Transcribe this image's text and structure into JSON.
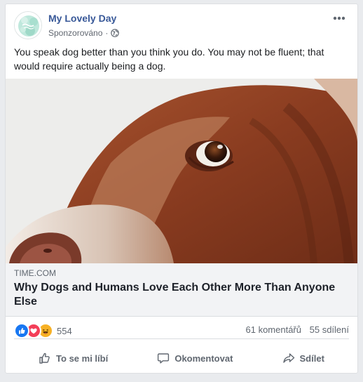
{
  "post": {
    "page_name": "My Lovely Day",
    "sponsored_label": "Sponzorováno",
    "sponsored_separator": "·",
    "text": "You speak dog better than you think you do. You may not be fluent; that would require actually being a dog."
  },
  "link": {
    "domain": "TIME.COM",
    "title": "Why Dogs and Humans Love Each Other More Than Anyone Else"
  },
  "stats": {
    "reaction_count": "554",
    "comments": "61 komentářů",
    "shares": "55 sdílení"
  },
  "actions": {
    "like": "To se mi líbí",
    "comment": "Okomentovat",
    "share": "Sdílet"
  },
  "colors": {
    "page_name": "#385898",
    "like_reaction": "#1877f2",
    "love_reaction": "#f33e58",
    "haha_reaction": "#f7b125"
  },
  "icons": [
    "page-avatar",
    "globe-icon",
    "more-options-icon",
    "like-reaction-icon",
    "love-reaction-icon",
    "haha-reaction-icon",
    "thumbs-up-icon",
    "comment-icon",
    "share-icon"
  ]
}
